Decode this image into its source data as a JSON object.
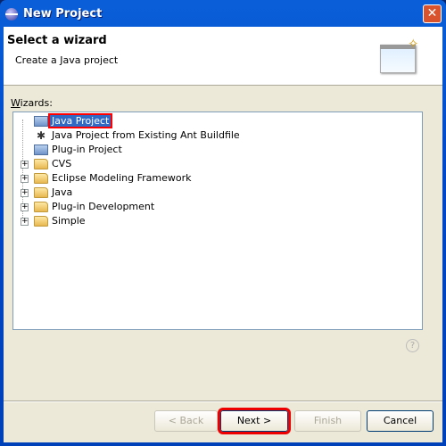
{
  "window": {
    "title": "New Project",
    "close_icon": "close-icon"
  },
  "header": {
    "title": "Select a wizard",
    "description": "Create a Java project"
  },
  "wizards": {
    "label": "Wizards:",
    "items": [
      {
        "label": "Java Project",
        "icon": "java-project-icon",
        "selected": true
      },
      {
        "label": "Java Project from Existing Ant Buildfile",
        "icon": "ant-icon"
      },
      {
        "label": "Plug-in Project",
        "icon": "plugin-project-icon"
      },
      {
        "label": "CVS",
        "icon": "folder-icon",
        "expandable": true
      },
      {
        "label": "Eclipse Modeling Framework",
        "icon": "folder-icon",
        "expandable": true
      },
      {
        "label": "Java",
        "icon": "folder-icon",
        "expandable": true
      },
      {
        "label": "Plug-in Development",
        "icon": "folder-icon",
        "expandable": true
      },
      {
        "label": "Simple",
        "icon": "folder-icon",
        "expandable": true
      }
    ]
  },
  "help": {
    "glyph": "?"
  },
  "buttons": {
    "back": "< Back",
    "next": "Next >",
    "finish": "Finish",
    "cancel": "Cancel"
  }
}
